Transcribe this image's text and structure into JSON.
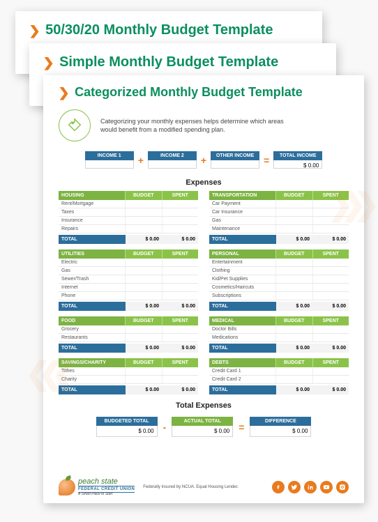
{
  "pages": {
    "back1_title": "50/30/20 Monthly Budget Template",
    "back2_title": "Simple Monthly Budget Template",
    "front_title": "Categorized Monthly Budget Template"
  },
  "intro": "Categorizing your monthly expenses helps determine which areas would benefit from a modified spending plan.",
  "income": {
    "boxes": [
      {
        "label": "INCOME 1",
        "value": ""
      },
      {
        "label": "INCOME 2",
        "value": ""
      },
      {
        "label": "OTHER INCOME",
        "value": ""
      },
      {
        "label": "TOTAL INCOME",
        "value": "$ 0.00"
      }
    ],
    "ops": [
      "+",
      "+",
      "="
    ]
  },
  "expenses_heading": "Expenses",
  "col_labels": {
    "budget": "BUDGET",
    "spent": "SPENT",
    "total": "TOTAL"
  },
  "zero": "$ 0.00",
  "table_pairs": [
    {
      "left": {
        "name": "HOUSING",
        "rows": [
          "Rent/Mortgage",
          "Taxes",
          "Insurance",
          "Repairs"
        ]
      },
      "right": {
        "name": "TRANSPORTATION",
        "rows": [
          "Car Payment",
          "Car Insurance",
          "Gas",
          "Maintenance"
        ]
      }
    },
    {
      "left": {
        "name": "UTILITIES",
        "rows": [
          "Electric",
          "Gas",
          "Sewer/Trash",
          "Internet",
          "Phone"
        ]
      },
      "right": {
        "name": "PERSONAL",
        "rows": [
          "Entertainment",
          "Clothing",
          "Kid/Pet Supplies",
          "Cosmetics/Haircuts",
          "Subscriptions"
        ]
      }
    },
    {
      "left": {
        "name": "FOOD",
        "rows": [
          "Grocery",
          "Restaurants"
        ]
      },
      "right": {
        "name": "MEDICAL",
        "rows": [
          "Doctor Bills",
          "Medications"
        ]
      }
    },
    {
      "left": {
        "name": "SAVINGS/CHARITY",
        "rows": [
          "Tithes",
          "Charity"
        ]
      },
      "right": {
        "name": "DEBTS",
        "rows": [
          "Credit Card 1",
          "Credit Card 2"
        ]
      }
    }
  ],
  "totals_heading": "Total Expenses",
  "totals": {
    "boxes": [
      {
        "label": "BUDGETED TOTAL",
        "value": "$ 0.00",
        "style": "blue"
      },
      {
        "label": "ACTUAL TOTAL",
        "value": "$ 0.00",
        "style": "green"
      },
      {
        "label": "DIFFERENCE",
        "value": "$ 0.00",
        "style": "blue"
      }
    ],
    "ops": [
      "-",
      "="
    ]
  },
  "footer": {
    "brand_line1": "peach state",
    "brand_line2": "FEDERAL CREDIT UNION",
    "brand_line3": "A Smart Place to Start",
    "disclaimer": "Federally insured by NCUA. Equal Housing Lender.",
    "socials": [
      "facebook",
      "twitter",
      "linkedin",
      "youtube",
      "instagram"
    ]
  }
}
